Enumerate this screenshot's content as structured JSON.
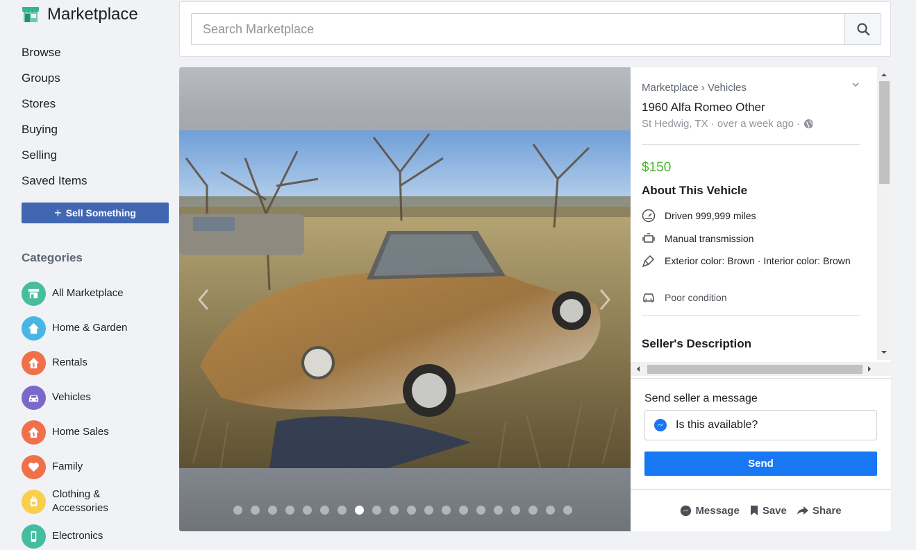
{
  "sidebar": {
    "title": "Marketplace",
    "nav": [
      "Browse",
      "Groups",
      "Stores",
      "Buying",
      "Selling",
      "Saved Items"
    ],
    "sell_button": "Sell Something",
    "categories_title": "Categories",
    "categories": [
      {
        "label": "All Marketplace",
        "icon": "storefront-icon",
        "color": "#45bd9e"
      },
      {
        "label": "Home & Garden",
        "icon": "house-icon",
        "color": "#47b6e6"
      },
      {
        "label": "Rentals",
        "icon": "rental-house-icon",
        "color": "#f0704a"
      },
      {
        "label": "Vehicles",
        "icon": "car-icon",
        "color": "#7b68c8"
      },
      {
        "label": "Home Sales",
        "icon": "home-sales-icon",
        "color": "#f0704a"
      },
      {
        "label": "Family",
        "icon": "heart-icon",
        "color": "#f0704a"
      },
      {
        "label": "Clothing & Accessories",
        "icon": "backpack-icon",
        "color": "#f7cf4b"
      },
      {
        "label": "Electronics",
        "icon": "phone-icon",
        "color": "#45bd9e"
      }
    ]
  },
  "search": {
    "placeholder": "Search Marketplace"
  },
  "listing": {
    "breadcrumb": "Marketplace › Vehicles",
    "title": "1960 Alfa Romeo Other",
    "meta": "St Hedwig, TX · over a week ago ·",
    "price": "$150",
    "about_title": "About This Vehicle",
    "attributes": [
      {
        "icon": "speedometer-icon",
        "text": "Driven 999,999 miles"
      },
      {
        "icon": "engine-icon",
        "text": "Manual transmission"
      },
      {
        "icon": "paintbrush-icon",
        "text": "Exterior color: Brown · Interior color: Brown"
      },
      {
        "icon": "car-icon",
        "text": "Poor condition"
      }
    ],
    "description_title": "Seller's Description",
    "photo_count": 20,
    "active_photo_index": 7
  },
  "message": {
    "label": "Send seller a message",
    "value": "Is this available?",
    "send": "Send"
  },
  "actions": {
    "message": "Message",
    "save": "Save",
    "share": "Share"
  },
  "colors": {
    "brand_blue": "#4267b2",
    "send_blue": "#1877f2",
    "price_green": "#42b72a"
  }
}
